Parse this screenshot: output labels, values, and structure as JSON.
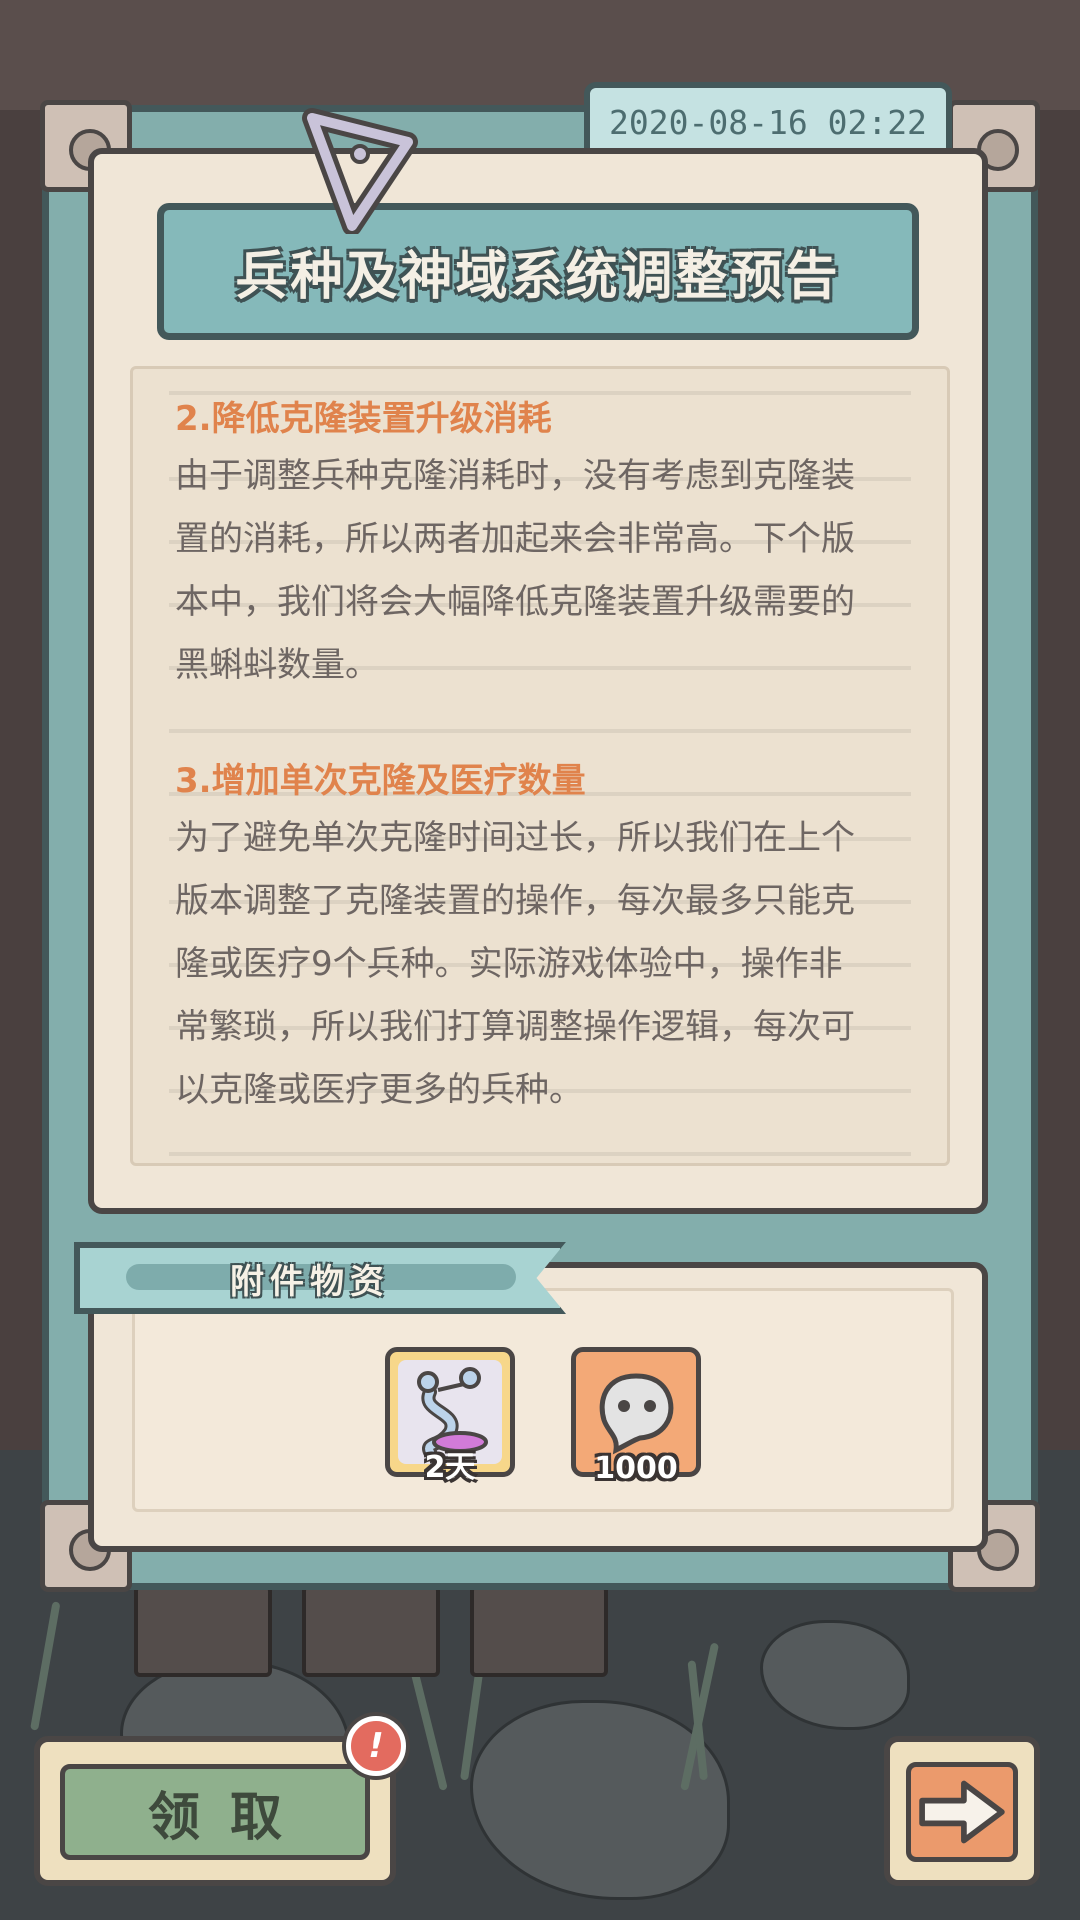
{
  "notice": {
    "date": "2020-08-16 02:22",
    "title": "兵种及神域系统调整预告",
    "sections": [
      {
        "heading": "2.降低克隆装置升级消耗",
        "lines": [
          "由于调整兵种克隆消耗时，没有考虑到克隆装",
          "置的消耗，所以两者加起来会非常高。下个版",
          "本中，我们将会大幅降低克隆装置升级需要的",
          "黑蝌蚪数量。"
        ]
      },
      {
        "heading": "3.增加单次克隆及医疗数量",
        "lines": [
          "为了避免单次克隆时间过长，所以我们在上个",
          "版本调整了克隆装置的操作，每次最多只能克",
          "隆或医疗9个兵种。实际游戏体验中，操作非",
          "常繁琐，所以我们打算调整操作逻辑，每次可",
          "以克隆或医疗更多的兵种。"
        ]
      }
    ]
  },
  "attachments": {
    "label": "附件物资",
    "items": [
      {
        "icon": "tadpole-creature-icon",
        "count": "2天"
      },
      {
        "icon": "ghost-bubble-icon",
        "count": "1000"
      }
    ]
  },
  "buttons": {
    "claim_label": "领取",
    "alert_mark": "!",
    "next_icon": "arrow-right-icon"
  },
  "colors": {
    "frame": "#83aeac",
    "paper": "#f0e6d7",
    "heading": "#e0834c",
    "body_text": "#6e6663",
    "claim_button": "#8fb08d",
    "next_button": "#eb9a6c"
  }
}
